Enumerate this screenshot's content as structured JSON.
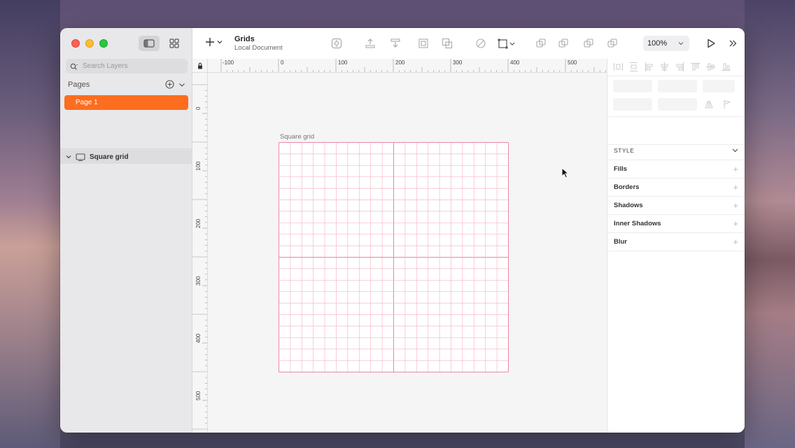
{
  "sidebar": {
    "search_placeholder": "Search Layers",
    "pages_title": "Pages",
    "pages": [
      "Page 1"
    ],
    "layers": [
      {
        "label": "Square grid"
      }
    ]
  },
  "toolbar": {
    "doc_name": "Grids",
    "doc_sub": "Local Document",
    "zoom": "100%"
  },
  "rulers": {
    "top": [
      "-100",
      "0",
      "100",
      "200",
      "300",
      "400",
      "500"
    ],
    "left": [
      "0",
      "100",
      "200",
      "300",
      "400",
      "500"
    ]
  },
  "canvas": {
    "artboard_title": "Square grid",
    "grid_color": "#f4b9c8",
    "grid_major_color": "#e88aa3"
  },
  "inspector": {
    "style_title": "STYLE",
    "sections": [
      "Fills",
      "Borders",
      "Shadows",
      "Inner Shadows",
      "Blur"
    ]
  },
  "colors": {
    "accent": "#fc6d1f"
  }
}
